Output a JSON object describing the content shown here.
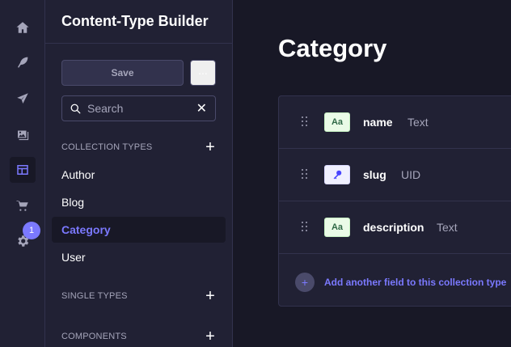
{
  "rail": {
    "icons": [
      "home-icon",
      "feather-icon",
      "send-icon",
      "images-icon",
      "layout-icon",
      "cart-icon",
      "gear-icon"
    ],
    "notification_count": "1",
    "accent": "#7b79ff"
  },
  "subnav": {
    "title": "Content-Type Builder",
    "save_label": "Save",
    "more_label": "...",
    "search_placeholder": "Search",
    "clear_label": "✕",
    "collection_types_label": "COLLECTION TYPES",
    "collection_types": [
      "Author",
      "Blog",
      "Category",
      "User"
    ],
    "active_item": "Category",
    "single_types_label": "SINGLE TYPES",
    "components_label": "COMPONENTS",
    "add_label": "+"
  },
  "main": {
    "title": "Category",
    "fields": [
      {
        "badge": "Aa",
        "name": "name",
        "type": "Text"
      },
      {
        "badge": "🔑",
        "name": "slug",
        "type": "UID"
      },
      {
        "badge": "Aa",
        "name": "description",
        "type": "Text"
      }
    ],
    "add_field_icon": "+",
    "add_field_label": "Add another field to this collection type"
  }
}
